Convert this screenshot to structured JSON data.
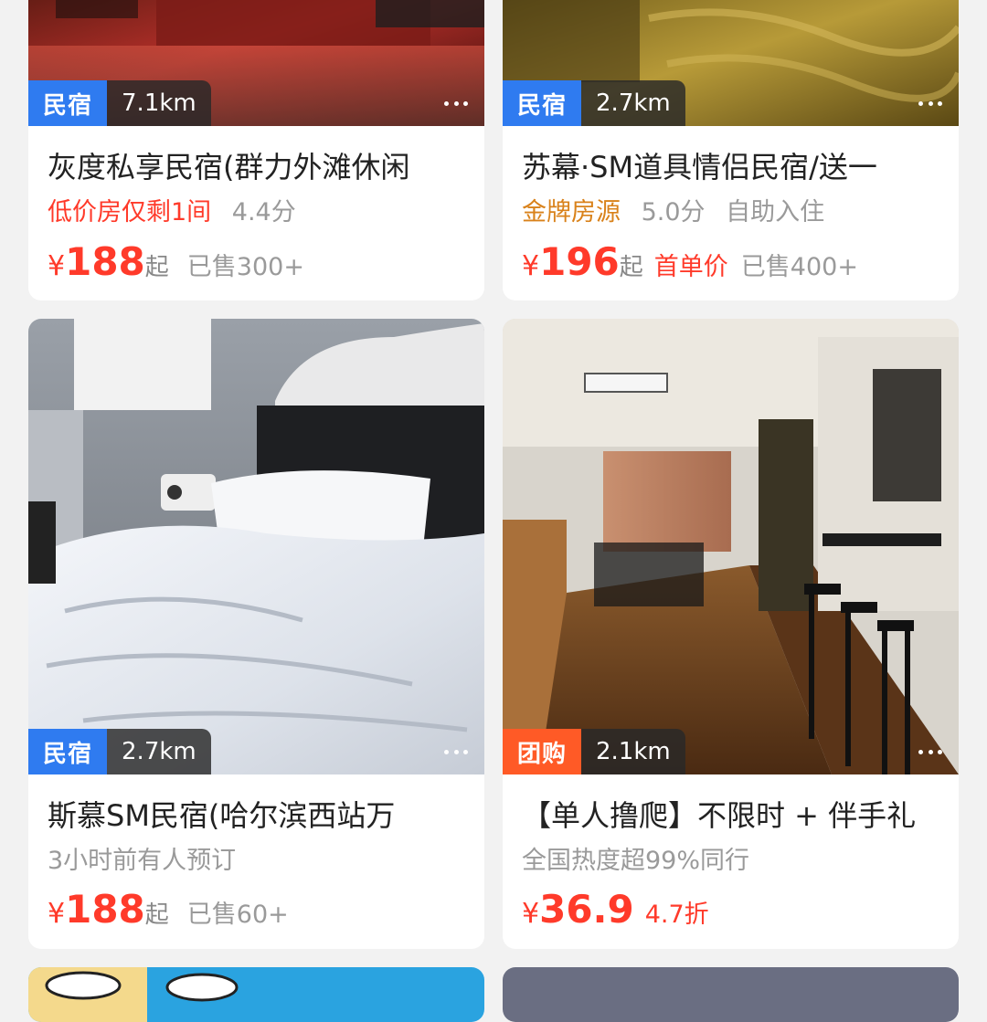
{
  "cards": [
    {
      "tag": "民宿",
      "distance": "7.1km",
      "title": "灰度私享民宿(群力外滩休闲",
      "info": [
        "低价房仅剩1间",
        "4.4分"
      ],
      "currency": "¥",
      "price": "188",
      "price_suffix": "起",
      "extra": "",
      "sold": "已售300+"
    },
    {
      "tag": "民宿",
      "distance": "2.7km",
      "title": "苏幕·SM道具情侣民宿/送一",
      "info": [
        "金牌房源",
        "5.0分",
        "自助入住"
      ],
      "currency": "¥",
      "price": "196",
      "price_suffix": "起",
      "extra": "首单价",
      "sold": "已售400+"
    },
    {
      "tag": "民宿",
      "distance": "2.7km",
      "title": "斯慕SM民宿(哈尔滨西站万",
      "info": [
        "3小时前有人预订"
      ],
      "currency": "¥",
      "price": "188",
      "price_suffix": "起",
      "extra": "",
      "sold": "已售60+"
    },
    {
      "tag": "团购",
      "distance": "2.1km",
      "title": "【单人撸爬】不限时 + 伴手礼",
      "info": [
        "全国热度超99%同行"
      ],
      "currency": "¥",
      "price": "36.9",
      "price_suffix": "",
      "extra": "4.7折",
      "sold": ""
    }
  ],
  "colors": {
    "price_red": "#ff3a2a",
    "tag_blue": "#2f7bf0",
    "tag_orange": "#ff5a26",
    "gold": "#d9821b"
  },
  "icons": [
    "more-dots-icon"
  ]
}
